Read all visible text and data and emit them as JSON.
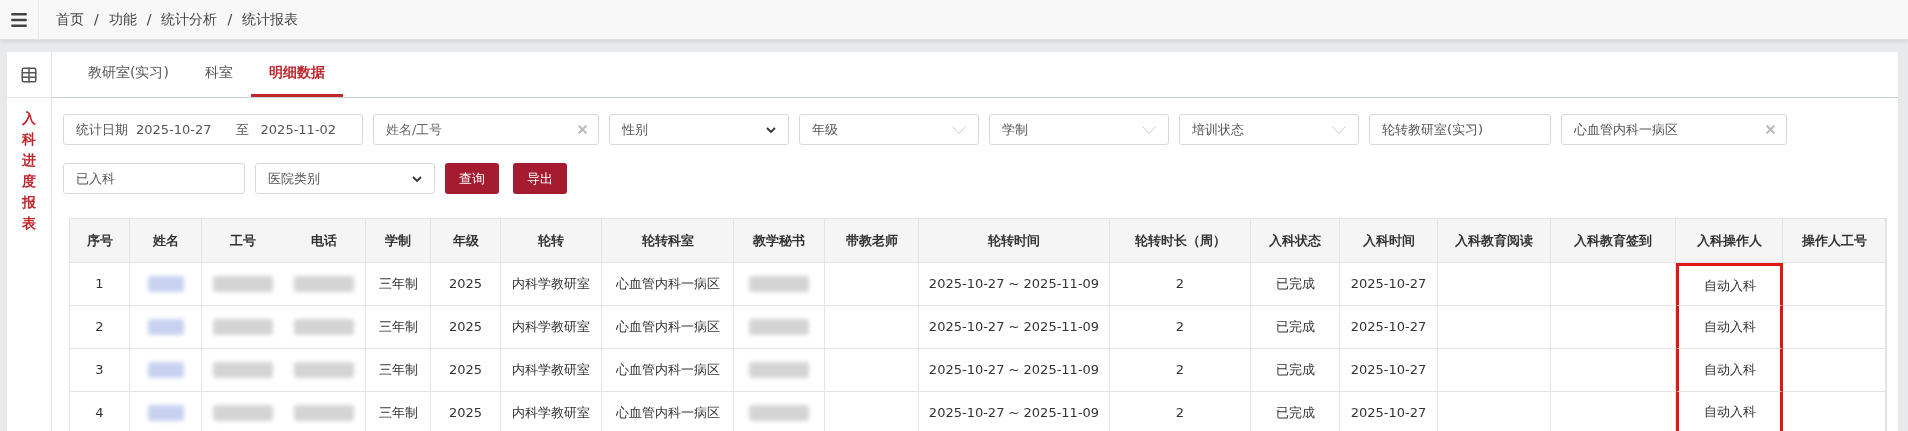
{
  "breadcrumb": {
    "separator": "/",
    "items": [
      "首页",
      "功能",
      "统计分析",
      "统计报表"
    ]
  },
  "sidebar": {
    "title": "入科进度报表"
  },
  "tabs": [
    {
      "label": "教研室(实习)",
      "selected": false
    },
    {
      "label": "科室",
      "selected": false
    },
    {
      "label": "明细数据",
      "selected": true
    }
  ],
  "filters": [
    {
      "kind": "date_range",
      "label": "统计日期",
      "from": "2025-10-27",
      "separator": "至",
      "to": "2025-11-02"
    },
    {
      "kind": "text",
      "placeholder": "姓名/工号",
      "clearable": true
    },
    {
      "kind": "select",
      "value": "性别"
    },
    {
      "kind": "dropdown",
      "value": "年级"
    },
    {
      "kind": "dropdown",
      "value": "学制"
    },
    {
      "kind": "dropdown",
      "value": "培训状态"
    },
    {
      "kind": "text",
      "value": "轮转教研室(实习)",
      "clearable": false
    },
    {
      "kind": "text",
      "value": "心血管内科一病区",
      "clearable": true
    },
    {
      "kind": "text",
      "value": "已入科",
      "clearable": false
    },
    {
      "kind": "select",
      "value": "医院类别"
    },
    {
      "kind": "button",
      "label": "查询"
    },
    {
      "kind": "button",
      "label": "导出"
    }
  ],
  "table": {
    "columns": [
      {
        "label": "序号",
        "highlighted": false
      },
      {
        "label": "姓名",
        "highlighted": false
      },
      {
        "label": "工号",
        "highlighted": false
      },
      {
        "label": "电话",
        "highlighted": false
      },
      {
        "label": "学制",
        "highlighted": false
      },
      {
        "label": "年级",
        "highlighted": false
      },
      {
        "label": "轮转",
        "highlighted": false
      },
      {
        "label": "轮转科室",
        "highlighted": false
      },
      {
        "label": "教学秘书",
        "highlighted": false
      },
      {
        "label": "带教老师",
        "highlighted": false
      },
      {
        "label": "轮转时间",
        "highlighted": false
      },
      {
        "label": "轮转时长（周）",
        "highlighted": false
      },
      {
        "label": "入科状态",
        "highlighted": false
      },
      {
        "label": "入科时间",
        "highlighted": false
      },
      {
        "label": "入科教育阅读",
        "highlighted": false
      },
      {
        "label": "入科教育签到",
        "highlighted": false
      },
      {
        "label": "入科操作人",
        "highlighted": true
      },
      {
        "label": "操作人工号",
        "highlighted": false
      }
    ],
    "rows": [
      {
        "cells": [
          {
            "text": "1"
          },
          {
            "kind": "redacted"
          },
          {
            "kind": "redacted"
          },
          {
            "kind": "redacted"
          },
          {
            "text": "三年制"
          },
          {
            "text": "2025"
          },
          {
            "text": "内科学教研室"
          },
          {
            "text": "心血管内科一病区"
          },
          {
            "kind": "redacted"
          },
          {},
          {
            "text": "2025-10-27 ~ 2025-11-09"
          },
          {
            "text": "2"
          },
          {
            "text": "已完成"
          },
          {
            "text": "2025-10-27"
          },
          {},
          {},
          {
            "text": "自动入科"
          },
          {}
        ]
      },
      {
        "cells": [
          {
            "text": "2"
          },
          {
            "kind": "redacted"
          },
          {
            "kind": "redacted"
          },
          {
            "kind": "redacted"
          },
          {
            "text": "三年制"
          },
          {
            "text": "2025"
          },
          {
            "text": "内科学教研室"
          },
          {
            "text": "心血管内科一病区"
          },
          {
            "kind": "redacted"
          },
          {},
          {
            "text": "2025-10-27 ~ 2025-11-09"
          },
          {
            "text": "2"
          },
          {
            "text": "已完成"
          },
          {
            "text": "2025-10-27"
          },
          {},
          {},
          {
            "text": "自动入科"
          },
          {}
        ]
      },
      {
        "cells": [
          {
            "text": "3"
          },
          {
            "kind": "redacted"
          },
          {
            "kind": "redacted"
          },
          {
            "kind": "redacted"
          },
          {
            "text": "三年制"
          },
          {
            "text": "2025"
          },
          {
            "text": "内科学教研室"
          },
          {
            "text": "心血管内科一病区"
          },
          {
            "kind": "redacted"
          },
          {},
          {
            "text": "2025-10-27 ~ 2025-11-09"
          },
          {
            "text": "2"
          },
          {
            "text": "已完成"
          },
          {
            "text": "2025-10-27"
          },
          {},
          {},
          {
            "text": "自动入科"
          },
          {}
        ]
      },
      {
        "cells": [
          {
            "text": "4"
          },
          {
            "kind": "redacted"
          },
          {
            "kind": "redacted"
          },
          {
            "kind": "redacted"
          },
          {
            "text": "三年制"
          },
          {
            "text": "2025"
          },
          {
            "text": "内科学教研室"
          },
          {
            "text": "心血管内科一病区"
          },
          {
            "kind": "redacted"
          },
          {},
          {
            "text": "2025-10-27 ~ 2025-11-09"
          },
          {
            "text": "2"
          },
          {
            "text": "已完成"
          },
          {
            "text": "2025-10-27"
          },
          {},
          {},
          {
            "text": "自动入科"
          },
          {}
        ]
      }
    ]
  }
}
